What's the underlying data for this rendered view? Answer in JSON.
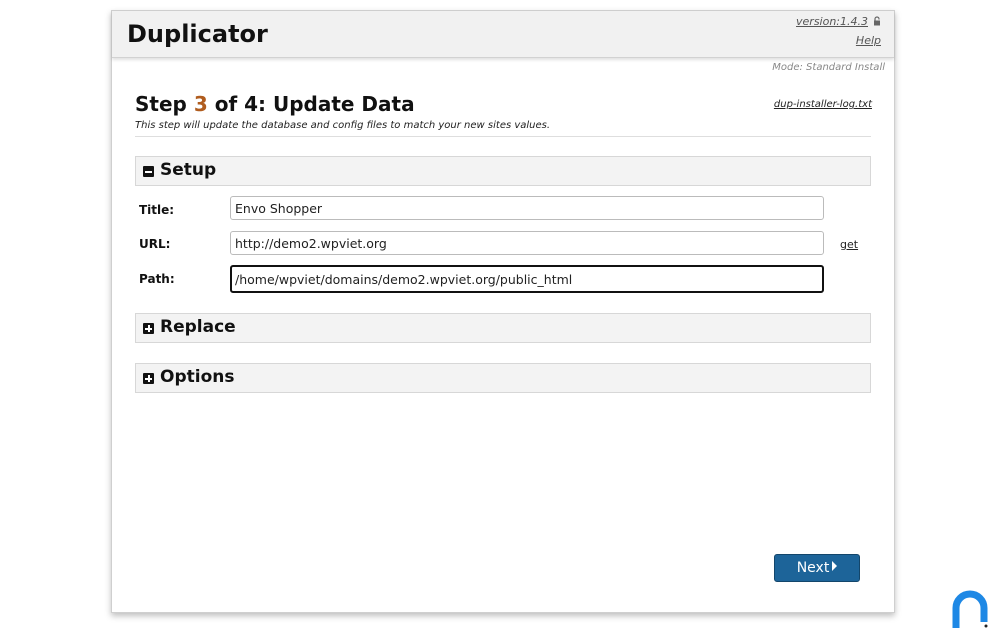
{
  "app": {
    "title": "Duplicator",
    "version": "version:1.4.3",
    "help_label": "Help",
    "mode": "Mode: Standard Install"
  },
  "step": {
    "prefix": "Step ",
    "number": "3",
    "suffix": " of 4: Update Data",
    "subtitle": "This step will update the database and config files to match your new sites values.",
    "log_link": "dup-installer-log.txt"
  },
  "sections": {
    "setup": {
      "label": "Setup",
      "state": "expanded"
    },
    "replace": {
      "label": "Replace",
      "state": "collapsed"
    },
    "options": {
      "label": "Options",
      "state": "collapsed"
    }
  },
  "fields": {
    "title": {
      "label": "Title:",
      "value": "Envo Shopper"
    },
    "url": {
      "label": "URL:",
      "value": "http://demo2.wpviet.org",
      "get_label": "get"
    },
    "path": {
      "label": "Path:",
      "value": "/home/wpviet/domains/demo2.wpviet.org/public_html"
    }
  },
  "buttons": {
    "next_label": "Next"
  },
  "colors": {
    "accent_step": "#b05c1e",
    "next_button": "#1d6499"
  },
  "icons": {
    "lock": "lock-icon",
    "collapse": "minus-square-icon",
    "expand": "plus-square-icon",
    "next": "caret-right-icon",
    "logo": "brand-logo-icon"
  }
}
